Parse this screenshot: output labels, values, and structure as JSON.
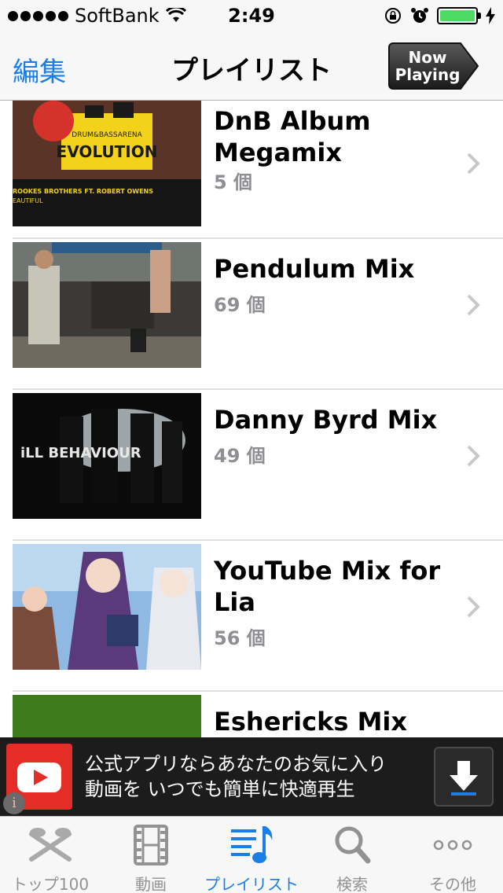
{
  "status_bar": {
    "carrier": "SoftBank",
    "time": "2:49"
  },
  "nav": {
    "edit_label": "編集",
    "title": "プレイリスト",
    "now_playing_line1": "Now",
    "now_playing_line2": "Playing"
  },
  "playlists": [
    {
      "title": "DnB Album Megamix",
      "count": "5 個"
    },
    {
      "title": "Pendulum Mix",
      "count": "69 個"
    },
    {
      "title": "Danny Byrd Mix",
      "count": "49 個"
    },
    {
      "title": "YouTube Mix for Lia",
      "count": "56 個"
    },
    {
      "title": "Eshericks Mix",
      "count": ""
    }
  ],
  "thumb_texts": {
    "evolution_brand": "DRUM&BASSARENA",
    "evolution_title": "EVOLUTION",
    "evolution_artist": "ROOKES BROTHERS FT. ROBERT OWENS",
    "evolution_sub": "EAUTIFUL",
    "ill_behaviour": "iLL BEHAVIOUR"
  },
  "ad": {
    "line1": "公式アプリならあなたのお気に入り",
    "line2": "動画を いつでも簡単に快適再生",
    "info_label": "i"
  },
  "tabs": [
    {
      "label": "トップ100",
      "icon": "top100-icon",
      "active": false
    },
    {
      "label": "動画",
      "icon": "film-icon",
      "active": false
    },
    {
      "label": "プレイリスト",
      "icon": "playlist-icon",
      "active": true
    },
    {
      "label": "検索",
      "icon": "search-icon",
      "active": false
    },
    {
      "label": "その他",
      "icon": "more-icon",
      "active": false
    }
  ],
  "colors": {
    "accent": "#1a7ee6",
    "battery": "#4cd964",
    "youtube_red": "#e52d27"
  }
}
